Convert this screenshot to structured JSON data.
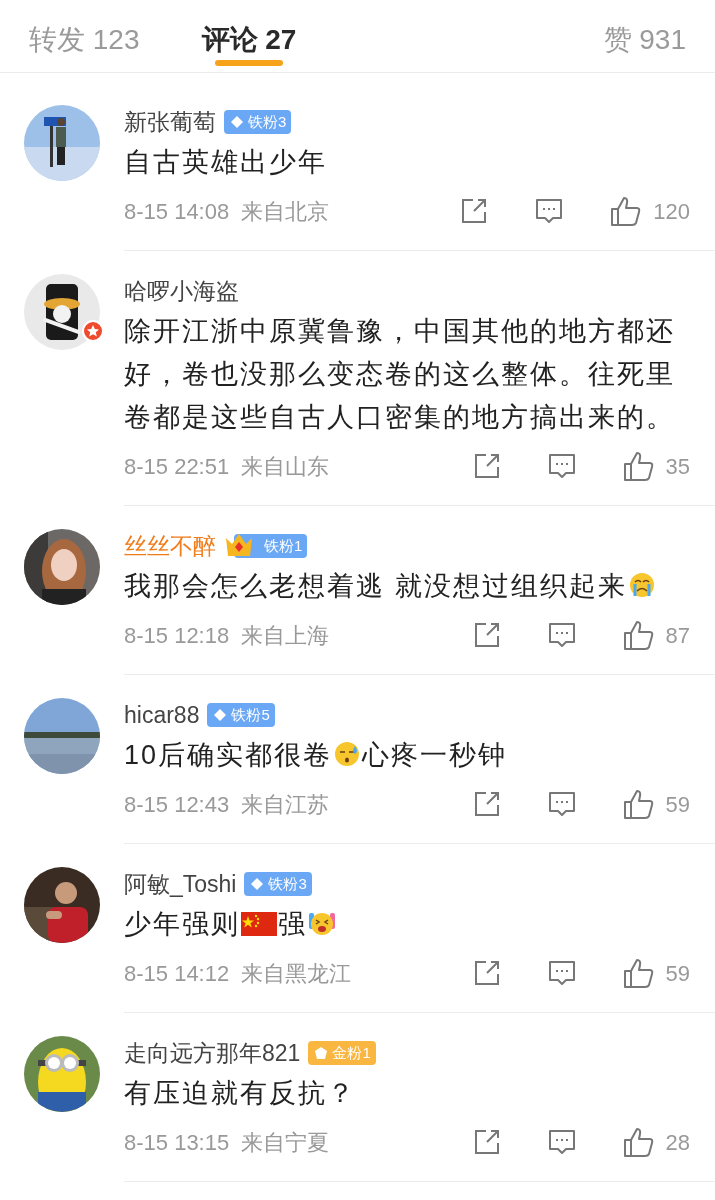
{
  "tabs": [
    {
      "label": "转发 123",
      "selected": false
    },
    {
      "label": "评论 27",
      "selected": true
    },
    {
      "label": "赞 931",
      "selected": false
    }
  ],
  "comments": [
    {
      "name": "新张葡萄",
      "vip": false,
      "verified": false,
      "badge": {
        "kind": "diamond",
        "label": "铁粉3"
      },
      "content": [
        {
          "kind": "text",
          "text": "自古英雄出少年"
        }
      ],
      "time": "8-15 14:08",
      "location": "来自北京",
      "likes": "120"
    },
    {
      "name": "哈啰小海盗",
      "vip": false,
      "verified": true,
      "content": [
        {
          "kind": "text",
          "text": "除开江浙中原冀鲁豫，中国其他的地方都还好，卷也没那么变态卷的这么整体。往死里卷都是这些自古人口密集的地方搞出来的。"
        }
      ],
      "time": "8-15 22:51",
      "location": "来自山东",
      "likes": "35"
    },
    {
      "name": "丝丝不醉",
      "vip": true,
      "verified": false,
      "badge": {
        "kind": "crown",
        "label": "铁粉1"
      },
      "content": [
        {
          "kind": "text",
          "text": "我那会怎么老想着逃 就没想过组织起来"
        },
        {
          "kind": "crying"
        }
      ],
      "time": "8-15 12:18",
      "location": "来自上海",
      "likes": "87"
    },
    {
      "name": "hicar88",
      "vip": false,
      "verified": false,
      "badge": {
        "kind": "diamond",
        "label": "铁粉5"
      },
      "content": [
        {
          "kind": "text",
          "text": "10后确实都很卷"
        },
        {
          "kind": "sweating"
        },
        {
          "kind": "text",
          "text": "心疼一秒钟"
        }
      ],
      "time": "8-15 12:43",
      "location": "来自江苏",
      "likes": "59"
    },
    {
      "name": "阿敏_Toshi",
      "vip": false,
      "verified": false,
      "badge": {
        "kind": "diamond",
        "label": "铁粉3"
      },
      "content": [
        {
          "kind": "text",
          "text": "少年强则"
        },
        {
          "kind": "flag"
        },
        {
          "kind": "text",
          "text": "强"
        },
        {
          "kind": "cheering"
        }
      ],
      "time": "8-15 14:12",
      "location": "来自黑龙江",
      "likes": "59"
    },
    {
      "name": "走向远方那年821",
      "vip": false,
      "verified": false,
      "badge": {
        "kind": "gold",
        "label": "金粉1"
      },
      "content": [
        {
          "kind": "text",
          "text": "有压迫就有反抗？"
        }
      ],
      "time": "8-15 13:15",
      "location": "来自宁夏",
      "likes": "28"
    }
  ]
}
